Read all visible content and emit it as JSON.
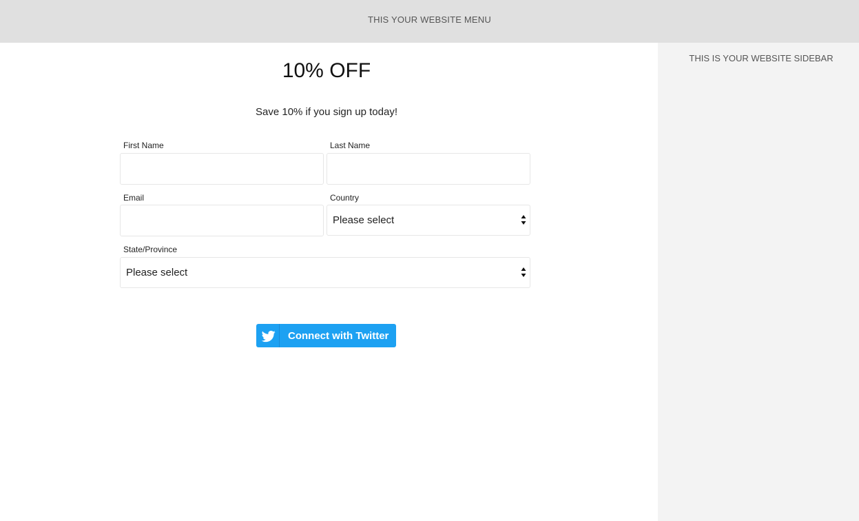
{
  "header": {
    "menu_text": "THIS YOUR WEBSITE MENU"
  },
  "sidebar": {
    "text": "THIS IS YOUR WEBSITE SIDEBAR"
  },
  "promo": {
    "title": "10% OFF",
    "subtitle": "Save 10% if you sign up today!"
  },
  "form": {
    "first_name_label": "First Name",
    "last_name_label": "Last Name",
    "email_label": "Email",
    "country_label": "Country",
    "country_value": "Please select",
    "state_label": "State/Province",
    "state_value": "Please select",
    "first_name_value": "",
    "last_name_value": "",
    "email_value": ""
  },
  "twitter": {
    "label": "Connect with Twitter",
    "icon": "twitter-bird-icon",
    "color": "#1da1f2"
  },
  "colors": {
    "header_bg": "#e0e0e0",
    "sidebar_bg": "#f3f3f3",
    "field_border": "#e6e6e6"
  }
}
